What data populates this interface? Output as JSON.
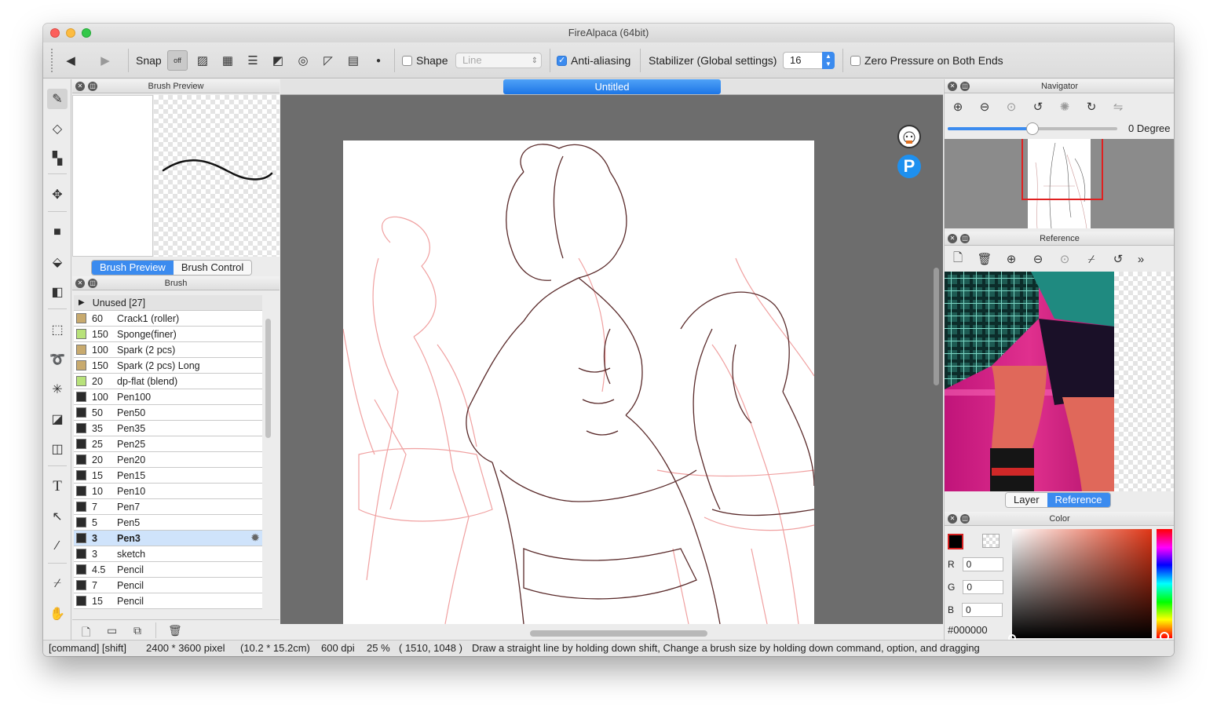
{
  "app": {
    "title": "FireAlpaca (64bit)"
  },
  "toolbar": {
    "snap_label": "Snap",
    "snap_off_label": "off",
    "shape_label": "Shape",
    "shape_select_value": "Line",
    "antialias_label": "Anti-aliasing",
    "antialias_checked": true,
    "stabilizer_label": "Stabilizer (Global settings)",
    "stabilizer_value": "16",
    "zero_pressure_label": "Zero Pressure on Both Ends"
  },
  "brush_preview": {
    "title": "Brush Preview",
    "tabs": [
      "Brush Preview",
      "Brush Control"
    ]
  },
  "brush_panel": {
    "title": "Brush",
    "group": "Unused [27]",
    "items": [
      {
        "size": "60",
        "name": "Crack1 (roller)",
        "color": "#c8aa6e"
      },
      {
        "size": "150",
        "name": "Sponge(finer)",
        "color": "#b8e27a"
      },
      {
        "size": "100",
        "name": "Spark (2 pcs)",
        "color": "#c8aa6e"
      },
      {
        "size": "150",
        "name": "Spark (2 pcs) Long",
        "color": "#c8aa6e"
      },
      {
        "size": "20",
        "name": "dp-flat (blend)",
        "color": "#b8e27a"
      },
      {
        "size": "100",
        "name": "Pen100",
        "color": "#2b2b2b"
      },
      {
        "size": "50",
        "name": "Pen50",
        "color": "#2b2b2b"
      },
      {
        "size": "35",
        "name": "Pen35",
        "color": "#2b2b2b"
      },
      {
        "size": "25",
        "name": "Pen25",
        "color": "#2b2b2b"
      },
      {
        "size": "20",
        "name": "Pen20",
        "color": "#2b2b2b"
      },
      {
        "size": "15",
        "name": "Pen15",
        "color": "#2b2b2b"
      },
      {
        "size": "10",
        "name": "Pen10",
        "color": "#2b2b2b"
      },
      {
        "size": "7",
        "name": "Pen7",
        "color": "#2b2b2b"
      },
      {
        "size": "5",
        "name": "Pen5",
        "color": "#2b2b2b"
      },
      {
        "size": "3",
        "name": "Pen3",
        "color": "#2b2b2b",
        "selected": true
      },
      {
        "size": "3",
        "name": "sketch",
        "color": "#2b2b2b"
      },
      {
        "size": "4.5",
        "name": "Pencil",
        "color": "#2b2b2b"
      },
      {
        "size": "7",
        "name": "Pencil",
        "color": "#2b2b2b"
      },
      {
        "size": "15",
        "name": "Pencil",
        "color": "#2b2b2b"
      }
    ]
  },
  "canvas": {
    "tab_title": "Untitled"
  },
  "navigator": {
    "title": "Navigator",
    "degree_label": "0 Degree",
    "rotation_fraction": 0.5
  },
  "reference": {
    "title": "Reference",
    "tabs": [
      "Layer",
      "Reference"
    ]
  },
  "color_panel": {
    "title": "Color",
    "r_label": "R",
    "r": "0",
    "g_label": "G",
    "g": "0",
    "b_label": "B",
    "b": "0",
    "hex": "#000000",
    "current_color": "#000000",
    "hue_color": "#e03616"
  },
  "status": {
    "modifiers": "[command] [shift]",
    "size": "2400 * 3600 pixel",
    "physical": "(10.2 * 15.2cm)",
    "dpi": "600 dpi",
    "zoom": "25 %",
    "coords": "( 1510, 1048 )",
    "hint": "Draw a straight line by holding down shift, Change a brush size by holding down command, option, and dragging"
  }
}
